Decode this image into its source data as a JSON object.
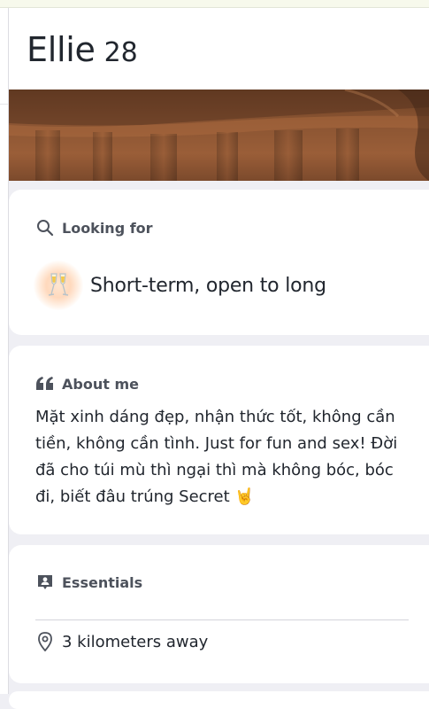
{
  "profile": {
    "name": "Ellie",
    "age": "28"
  },
  "looking_for": {
    "heading": "Looking for",
    "icon": "search-icon",
    "emoji": "champagne-glasses-emoji",
    "value": "Short-term, open to long"
  },
  "about": {
    "heading": "About me",
    "icon": "quote-icon",
    "text": "Mặt xinh dáng đẹp, nhận thức tốt, không cần tiền, không cần tình. Just for fun and sex! Đời đã cho túi mù thì ngại thì mà không bóc, bóc đi, biết đâu trúng Secret 🤘"
  },
  "essentials": {
    "heading": "Essentials",
    "icon": "profile-card-icon",
    "distance_icon": "location-pin-icon",
    "distance": "3 kilometers away"
  },
  "colors": {
    "text": "#21262e",
    "muted": "#4d525c",
    "background": "#efeff4",
    "card": "#ffffff",
    "photo": "#8a5432"
  }
}
